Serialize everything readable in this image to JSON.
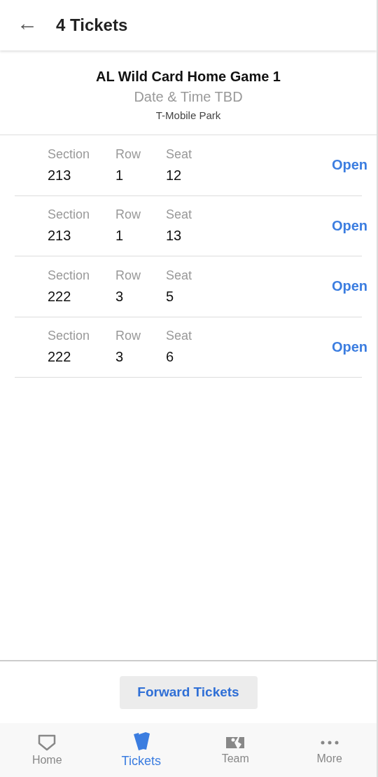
{
  "header": {
    "back": "←",
    "title": "4 Tickets"
  },
  "event": {
    "name": "AL Wild Card Home Game 1",
    "datetime": "Date & Time TBD",
    "venue": "T-Mobile Park"
  },
  "tickets": [
    {
      "section_label": "Section",
      "section": "213",
      "row_label": "Row",
      "row": "1",
      "seat_label": "Seat",
      "seat": "12",
      "action": "Open"
    },
    {
      "section_label": "Section",
      "section": "213",
      "row_label": "Row",
      "row": "1",
      "seat_label": "Seat",
      "seat": "13",
      "action": "Open"
    },
    {
      "section_label": "Section",
      "section": "222",
      "row_label": "Row",
      "row": "3",
      "seat_label": "Seat",
      "seat": "5",
      "action": "Open"
    },
    {
      "section_label": "Section",
      "section": "222",
      "row_label": "Row",
      "row": "3",
      "seat_label": "Seat",
      "seat": "6",
      "action": "Open"
    }
  ],
  "forward_button": "Forward Tickets",
  "tabs": [
    {
      "kind": "home",
      "label": "Home",
      "selected": false
    },
    {
      "kind": "tickets",
      "label": "Tickets",
      "selected": true
    },
    {
      "kind": "team",
      "label": "Team",
      "selected": false
    },
    {
      "kind": "more",
      "label": "More",
      "selected": false
    }
  ]
}
